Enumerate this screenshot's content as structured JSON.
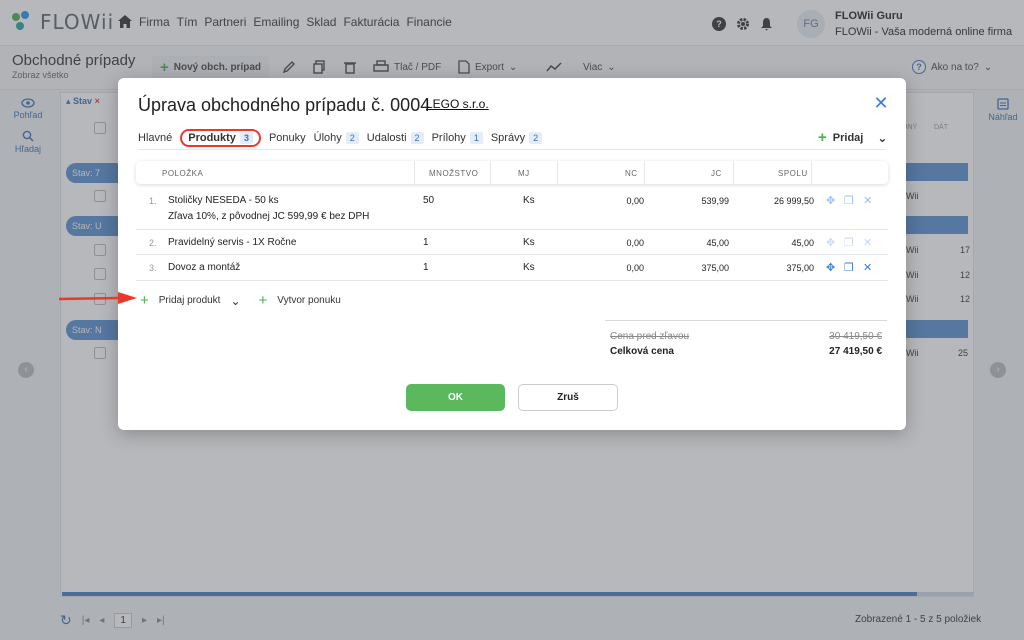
{
  "app": {
    "logo_text": "FLOWii",
    "nav": [
      "Firma",
      "Tím",
      "Partneri",
      "Emailing",
      "Sklad",
      "Fakturácia",
      "Financie"
    ],
    "user_initials": "FG",
    "user_name": "FLOWii Guru",
    "user_tagline": "FLOWii - Vaša moderná online firma"
  },
  "toolbar": {
    "title": "Obchodné prípady",
    "subtitle": "Zobraz všetko",
    "new_case": "Nový obch. prípad",
    "print_pdf": "Tlač / PDF",
    "export": "Export",
    "more": "Viac",
    "how_to": "Ako na to?"
  },
  "sidebar_left": {
    "view": "Pohľad",
    "search": "Hľadaj"
  },
  "sidebar_right": {
    "preview": "Náhľad"
  },
  "background_table": {
    "filter_chip": "Stav",
    "groups": [
      "Stav: 7",
      "Stav: U",
      "Stav: N"
    ],
    "col_fragments": [
      "ONÝ",
      "DÁT"
    ],
    "right_fragments": [
      "Wii",
      "Wii",
      "Wii",
      "Wii",
      "Wii"
    ],
    "right_numbers": [
      "17",
      "12",
      "12",
      "25"
    ]
  },
  "pager": {
    "page": "1",
    "status": "Zobrazené 1 - 5 z 5 položiek"
  },
  "modal": {
    "title": "Úprava obchodného prípadu č. 0004",
    "company": "LEGO s.r.o.",
    "close": "✕",
    "tabs": [
      {
        "label": "Hlavné",
        "badge": ""
      },
      {
        "label": "Produkty",
        "badge": "3"
      },
      {
        "label": "Ponuky",
        "badge": ""
      },
      {
        "label": "Úlohy",
        "badge": "2"
      },
      {
        "label": "Udalosti",
        "badge": "2"
      },
      {
        "label": "Prílohy",
        "badge": "1"
      },
      {
        "label": "Správy",
        "badge": "2"
      }
    ],
    "add_label": "Pridaj",
    "columns": {
      "item": "POLOŽKA",
      "qty": "MNOŽSTVO",
      "unit": "MJ",
      "nc": "NC",
      "jc": "JC",
      "total": "SPOLU"
    },
    "rows": [
      {
        "num": "1.",
        "name": "Stoličky NESEDA - 50 ks",
        "note": "Zľava 10%, z pôvodnej JC 599,99 € bez DPH",
        "qty": "50",
        "unit": "Ks",
        "nc": "0,00",
        "jc": "539,99",
        "total": "26 999,50"
      },
      {
        "num": "2.",
        "name": "Pravidelný servis - 1X Ročne",
        "note": "",
        "qty": "1",
        "unit": "Ks",
        "nc": "0,00",
        "jc": "45,00",
        "total": "45,00"
      },
      {
        "num": "3.",
        "name": "Dovoz a montáž",
        "note": "",
        "qty": "1",
        "unit": "Ks",
        "nc": "0,00",
        "jc": "375,00",
        "total": "375,00"
      }
    ],
    "add_product": "Pridaj produkt",
    "create_offer": "Vytvor ponuku",
    "totals": {
      "before_discount_label": "Cena pred zľavou",
      "before_discount_value": "30 419,50 €",
      "total_label": "Celková cena",
      "total_value": "27 419,50 €"
    },
    "ok": "OK",
    "cancel": "Zruš"
  },
  "colors": {
    "accent_blue": "#3b7dd8",
    "group_blue": "#5b8fd0",
    "ok_green": "#5cb85c",
    "highlight_red": "#e8392c"
  }
}
